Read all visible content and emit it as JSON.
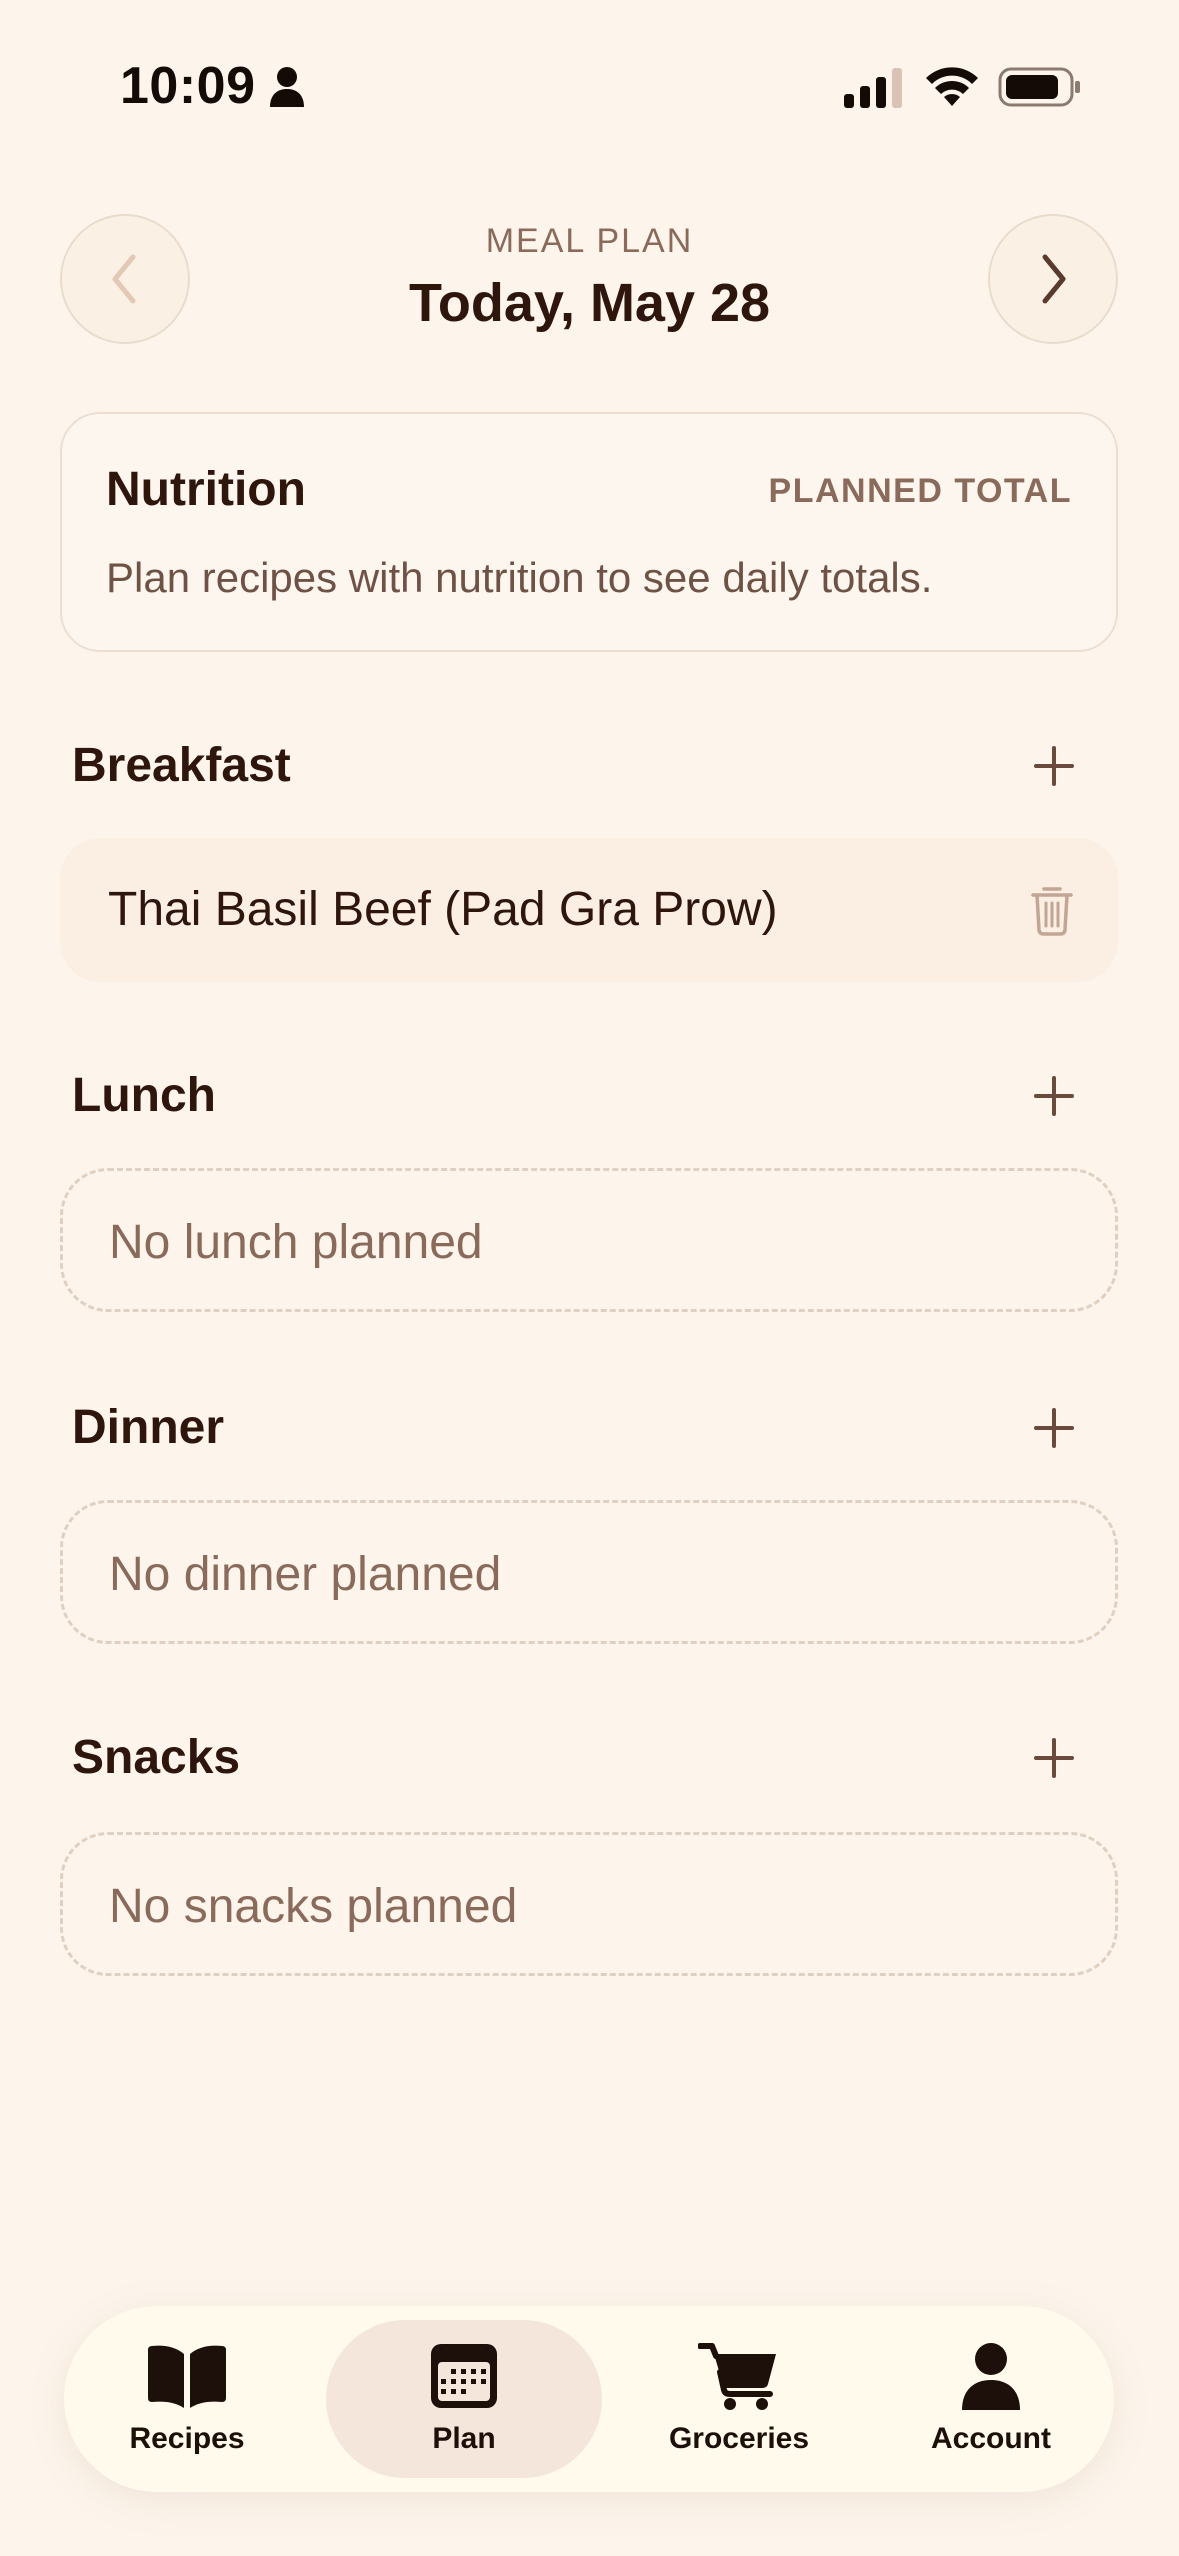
{
  "status_bar": {
    "time": "10:09",
    "icons": [
      "person-icon",
      "signal-icon",
      "wifi-icon",
      "battery-icon"
    ]
  },
  "header": {
    "kicker": "MEAL PLAN",
    "title": "Today, May 28",
    "prev_icon": "chevron-left-icon",
    "next_icon": "chevron-right-icon"
  },
  "nutrition": {
    "title": "Nutrition",
    "kicker": "PLANNED TOTAL",
    "note": "Plan recipes with nutrition to see daily totals."
  },
  "sections": {
    "breakfast": {
      "title": "Breakfast",
      "items": [
        {
          "name": "Thai Basil Beef (Pad Gra Prow)",
          "action_icon": "trash-icon"
        }
      ]
    },
    "lunch": {
      "title": "Lunch",
      "empty": "No lunch planned"
    },
    "dinner": {
      "title": "Dinner",
      "empty": "No dinner planned"
    },
    "snacks": {
      "title": "Snacks",
      "empty": "No snacks planned"
    }
  },
  "tab_bar": {
    "tabs": [
      {
        "label": "Recipes",
        "icon": "book-icon"
      },
      {
        "label": "Plan",
        "icon": "calendar-icon",
        "active": true
      },
      {
        "label": "Groceries",
        "icon": "cart-icon"
      },
      {
        "label": "Account",
        "icon": "person-icon"
      }
    ]
  },
  "colors": {
    "background": "#fdf5ec",
    "text_primary": "#2e160d",
    "text_muted": "#8a6a5b",
    "tab_active": "#f4e6da",
    "tab_bar": "#fffaec"
  }
}
